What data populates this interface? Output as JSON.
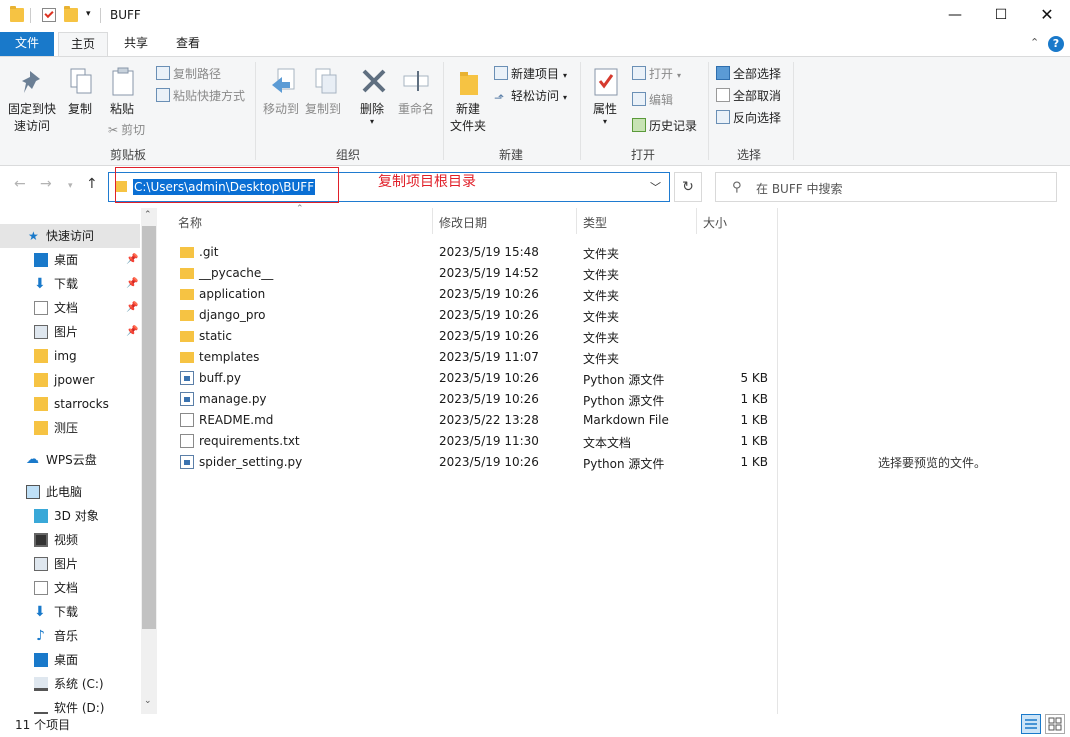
{
  "window": {
    "title": "BUFF"
  },
  "ribbon_tabs": {
    "file": "文件",
    "home": "主页",
    "share": "共享",
    "view": "查看"
  },
  "clipboard": {
    "pin": "固定到快\n速访问",
    "pin_l1": "固定到快",
    "pin_l2": "速访问",
    "copy": "复制",
    "paste": "粘贴",
    "copy_path": "复制路径",
    "paste_shortcut": "粘贴快捷方式",
    "cut": "剪切",
    "label": "剪贴板"
  },
  "organize": {
    "move_to": "移动到",
    "copy_to": "复制到",
    "delete": "删除",
    "rename": "重命名",
    "label": "组织"
  },
  "new": {
    "new_folder_l1": "新建",
    "new_folder_l2": "文件夹",
    "new_item": "新建项目",
    "easy_access": "轻松访问",
    "label": "新建"
  },
  "open": {
    "properties": "属性",
    "open": "打开",
    "edit": "编辑",
    "history": "历史记录",
    "label": "打开"
  },
  "select": {
    "select_all": "全部选择",
    "select_none": "全部取消",
    "invert": "反向选择",
    "label": "选择"
  },
  "address": {
    "path": "C:\\Users\\admin\\Desktop\\BUFF",
    "annotation": "复制项目根目录"
  },
  "search": {
    "placeholder": "在 BUFF 中搜索"
  },
  "nav": {
    "quick_access": "快速访问",
    "quick_items": [
      "桌面",
      "下载",
      "文档",
      "图片",
      "img",
      "jpower",
      "starrocks",
      "测压"
    ],
    "wps": "WPS云盘",
    "this_pc": "此电脑",
    "pc_items": [
      "3D 对象",
      "视频",
      "图片",
      "文档",
      "下载",
      "音乐",
      "桌面",
      "系统 (C:)",
      "软件 (D:)"
    ]
  },
  "columns": {
    "name": "名称",
    "date": "修改日期",
    "type": "类型",
    "size": "大小"
  },
  "files": [
    {
      "name": ".git",
      "date": "2023/5/19 15:48",
      "type": "文件夹",
      "size": ""
    },
    {
      "name": "__pycache__",
      "date": "2023/5/19 14:52",
      "type": "文件夹",
      "size": ""
    },
    {
      "name": "application",
      "date": "2023/5/19 10:26",
      "type": "文件夹",
      "size": ""
    },
    {
      "name": "django_pro",
      "date": "2023/5/19 10:26",
      "type": "文件夹",
      "size": ""
    },
    {
      "name": "static",
      "date": "2023/5/19 10:26",
      "type": "文件夹",
      "size": ""
    },
    {
      "name": "templates",
      "date": "2023/5/19 11:07",
      "type": "文件夹",
      "size": ""
    },
    {
      "name": "buff.py",
      "date": "2023/5/19 10:26",
      "type": "Python 源文件",
      "size": "5 KB"
    },
    {
      "name": "manage.py",
      "date": "2023/5/19 10:26",
      "type": "Python 源文件",
      "size": "1 KB"
    },
    {
      "name": "README.md",
      "date": "2023/5/22 13:28",
      "type": "Markdown File",
      "size": "1 KB"
    },
    {
      "name": "requirements.txt",
      "date": "2023/5/19 11:30",
      "type": "文本文档",
      "size": "1 KB"
    },
    {
      "name": "spider_setting.py",
      "date": "2023/5/19 10:26",
      "type": "Python 源文件",
      "size": "1 KB"
    }
  ],
  "preview": {
    "empty_text": "选择要预览的文件。"
  },
  "status": {
    "count": "11 个项目"
  },
  "colors": {
    "accent": "#1979ca",
    "annotation": "#e0202a",
    "folder": "#f6c343"
  }
}
